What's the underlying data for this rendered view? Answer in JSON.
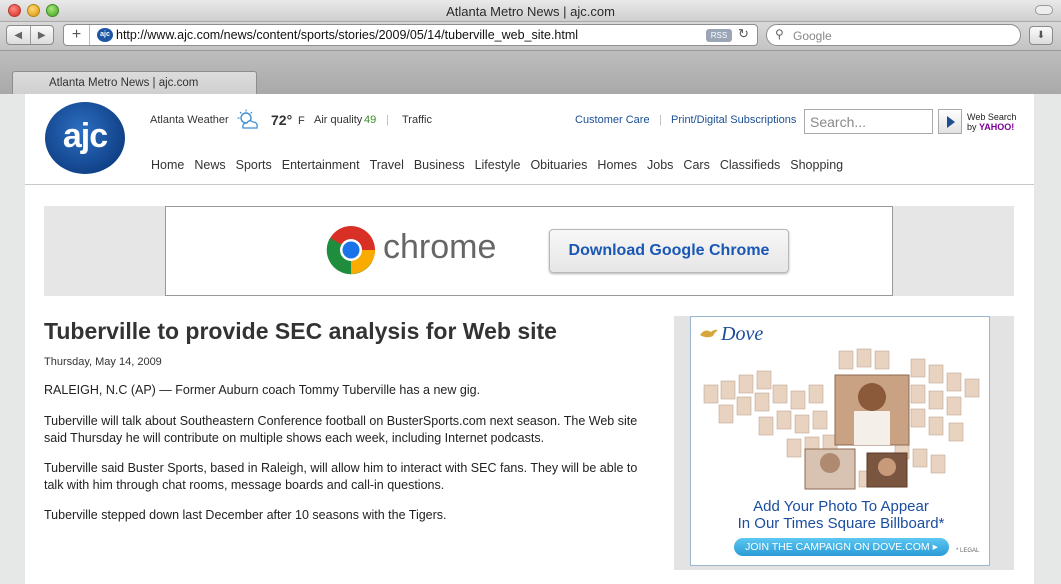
{
  "window": {
    "title": "Atlanta Metro News | ajc.com",
    "url": "http://www.ajc.com/news/content/sports/stories/2009/05/14/tuberville_web_site.html",
    "rss_label": "RSS",
    "search_placeholder": "Google",
    "tab_label": "Atlanta Metro News | ajc.com"
  },
  "header": {
    "logo_text": "ajc",
    "weather_label": "Atlanta Weather",
    "temperature": "72°",
    "temp_unit": "F",
    "air_quality_label": "Air quality",
    "air_quality_value": "49",
    "separator": "|",
    "traffic_label": "Traffic",
    "customer_care": "Customer Care",
    "subscriptions": "Print/Digital Subscriptions",
    "search_placeholder": "Search...",
    "websearch_line1": "Web Search",
    "websearch_by": "by",
    "websearch_brand": "YAHOO!"
  },
  "nav": {
    "items": [
      "Home",
      "News",
      "Sports",
      "Entertainment",
      "Travel",
      "Business",
      "Lifestyle",
      "Obituaries",
      "Homes",
      "Jobs",
      "Cars",
      "Classifieds",
      "Shopping"
    ]
  },
  "banner_ad": {
    "brand": "chrome",
    "button": "Download Google Chrome"
  },
  "article": {
    "headline": "Tuberville to provide SEC analysis for Web site",
    "date": "Thursday, May 14, 2009",
    "paragraphs": [
      "RALEIGH, N.C (AP) — Former Auburn coach Tommy Tuberville has a new gig.",
      "Tuberville will talk about Southeastern Conference football on BusterSports.com next season. The Web site said Thursday he will contribute on multiple shows each week, including Internet podcasts.",
      "Tuberville said Buster Sports, based in Raleigh, will allow him to interact with SEC fans. They will be able to talk with him through chat rooms, message boards and call-in questions.",
      "Tuberville stepped down last December after 10 seasons with the Tigers."
    ]
  },
  "side_ad": {
    "brand": "Dove",
    "headline_line1": "Add Your Photo To Appear",
    "headline_line2": "In Our Times Square Billboard*",
    "cta": "JOIN THE CAMPAIGN ON DOVE.COM ▸",
    "legal": "* LEGAL"
  },
  "colors": {
    "link_blue": "#1b4f93",
    "air_quality_green": "#3a8d2a",
    "chrome_button_text": "#1a57b5",
    "dove_blue": "#1a4d9e"
  }
}
